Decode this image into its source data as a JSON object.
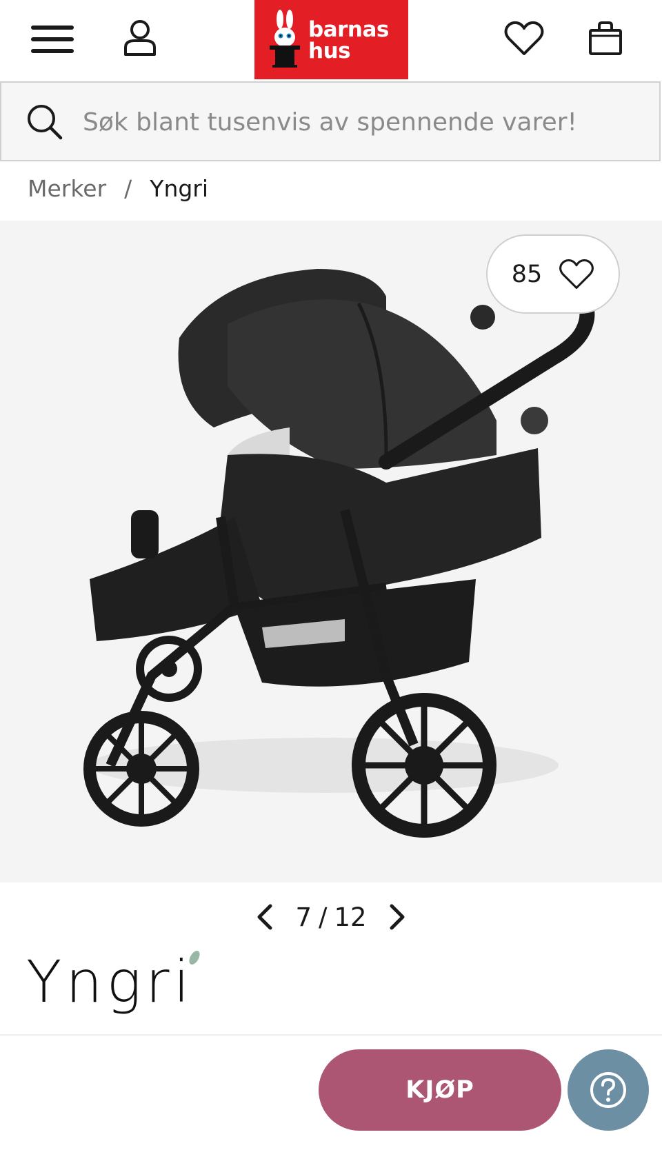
{
  "header": {
    "logo_line1": "barnas",
    "logo_line2": "hus",
    "brand_color": "#e31e24",
    "icons": [
      "menu-icon",
      "account-icon",
      "heart-icon",
      "shopping-bag-icon"
    ]
  },
  "search": {
    "placeholder": "Søk blant tusenvis av spennende varer!",
    "value": ""
  },
  "breadcrumb": {
    "items": [
      "Merker",
      "Yngri"
    ],
    "separator": "/"
  },
  "gallery": {
    "image_alt": "Yngri double stroller",
    "likes": "85",
    "current": "7",
    "separator": "/",
    "total": "12"
  },
  "brand": {
    "name": "Yngri"
  },
  "actions": {
    "buy_label": "KJØP",
    "buy_color": "#ad5673",
    "help_color": "#6d8fa3"
  }
}
